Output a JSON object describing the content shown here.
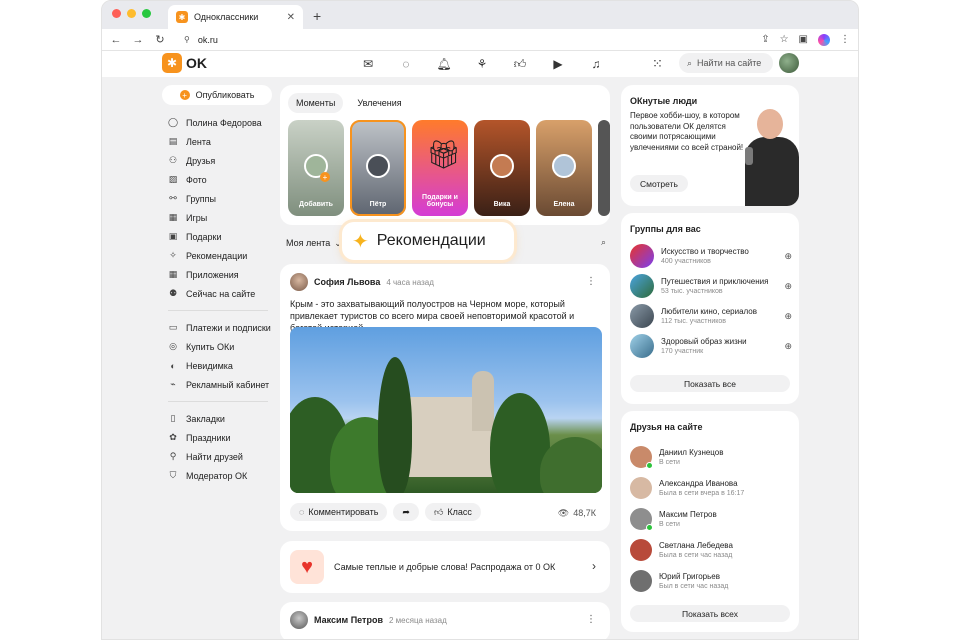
{
  "browser": {
    "tab_title": "Одноклассники",
    "url": "ok.ru"
  },
  "header": {
    "logo_text": "OK",
    "search_placeholder": "Найти на сайте"
  },
  "sidebar": {
    "publish_label": "Опубликовать",
    "items": [
      {
        "label": "Полина Федорова",
        "icon": "user-icon"
      },
      {
        "label": "Лента",
        "icon": "feed-icon"
      },
      {
        "label": "Друзья",
        "icon": "friends-icon"
      },
      {
        "label": "Фото",
        "icon": "photo-icon"
      },
      {
        "label": "Группы",
        "icon": "groups-icon"
      },
      {
        "label": "Игры",
        "icon": "games-icon"
      },
      {
        "label": "Подарки",
        "icon": "gift-icon"
      },
      {
        "label": "Рекомендации",
        "icon": "recommend-icon"
      },
      {
        "label": "Приложения",
        "icon": "apps-icon"
      },
      {
        "label": "Сейчас на сайте",
        "icon": "online-icon"
      },
      {
        "label": "Платежи и подписки",
        "icon": "payments-icon"
      },
      {
        "label": "Купить ОКи",
        "icon": "coin-icon"
      },
      {
        "label": "Невидимка",
        "icon": "invisible-icon"
      },
      {
        "label": "Рекламный кабинет",
        "icon": "ads-icon"
      },
      {
        "label": "Закладки",
        "icon": "bookmark-icon"
      },
      {
        "label": "Праздники",
        "icon": "holiday-icon"
      },
      {
        "label": "Найти друзей",
        "icon": "find-friends-icon"
      },
      {
        "label": "Модератор ОК",
        "icon": "moderator-icon"
      }
    ]
  },
  "stories": {
    "tabs": [
      "Моменты",
      "Увлечения"
    ],
    "cards": [
      {
        "label": "Добавить"
      },
      {
        "label": "Пётр"
      },
      {
        "label": "Подарки и бонусы"
      },
      {
        "label": "Вика"
      },
      {
        "label": "Елена"
      }
    ]
  },
  "feed": {
    "selector_label": "Моя лента",
    "recommend_label": "Рекомендации"
  },
  "post": {
    "author": "София Львова",
    "time": "4 часа назад",
    "text": "Крым - это захватывающий полуостров на Черном море, который привлекает туристов со всего мира своей неповторимой красотой и богатой историей",
    "comment_label": "Комментировать",
    "class_label": "Класс",
    "views": "48,7К"
  },
  "promo": {
    "text": "Самые теплые и добрые слова! Распродажа от 0 ОК"
  },
  "post2": {
    "author": "Максим Петров",
    "time": "2 месяца назад"
  },
  "okn": {
    "title": "ОКнутые люди",
    "text": "Первое хобби-шоу, в котором пользователи ОК делятся своими потрясающими увлечениями со всей страной!",
    "button": "Смотреть"
  },
  "groups": {
    "title": "Группы для вас",
    "items": [
      {
        "name": "Искусство и творчество",
        "sub": "400 участников"
      },
      {
        "name": "Путешествия и приключения",
        "sub": "53 тыс. участников"
      },
      {
        "name": "Любители кино, сериалов",
        "sub": "112 тыс. участников"
      },
      {
        "name": "Здоровый образ жизни",
        "sub": "170 участник"
      }
    ],
    "button": "Показать все"
  },
  "friends": {
    "title": "Друзья на сайте",
    "items": [
      {
        "name": "Даниил Кузнецов",
        "status": "В сети",
        "online": true
      },
      {
        "name": "Александра Иванова",
        "status": "Была в сети вчера в 16:17",
        "online": false
      },
      {
        "name": "Максим Петров",
        "status": "В сети",
        "online": true
      },
      {
        "name": "Светлана Лебедева",
        "status": "Была в сети час назад",
        "online": false
      },
      {
        "name": "Юрий Григорьев",
        "status": "Был в сети час назад",
        "online": false
      }
    ],
    "button": "Показать всех"
  },
  "colors": {
    "brand": "#f7931e",
    "online": "#2dc33c"
  }
}
